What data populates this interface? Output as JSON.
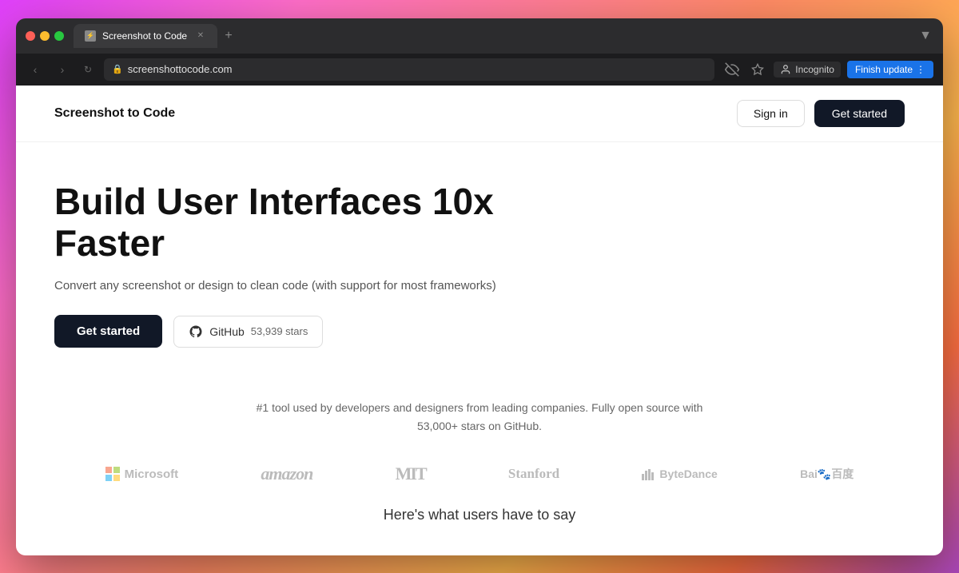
{
  "browser": {
    "tab_title": "Screenshot to Code",
    "tab_icon": "⚡",
    "new_tab_label": "+",
    "expand_label": "▼",
    "back_label": "‹",
    "forward_label": "›",
    "refresh_label": "↻",
    "url": "screenshottocode.com",
    "url_icon": "🔒",
    "eyeoff_icon": "👁",
    "bookmark_icon": "☆",
    "incognito_label": "Incognito",
    "incognito_icon": "🕵",
    "finish_update_label": "Finish update",
    "more_icon": "⋮"
  },
  "nav": {
    "logo": "Screenshot to Code",
    "sign_in": "Sign in",
    "get_started": "Get started"
  },
  "hero": {
    "title": "Build User Interfaces 10x Faster",
    "subtitle": "Convert any screenshot or design to clean code (with support for most frameworks)",
    "get_started": "Get started",
    "github_label": "GitHub",
    "github_stars": "53,939 stars"
  },
  "social_proof": {
    "text": "#1 tool used by developers and designers from leading companies. Fully open source with 53,000+ stars on GitHub.",
    "companies": [
      {
        "name": "Microsoft",
        "id": "microsoft"
      },
      {
        "name": "amazon",
        "id": "amazon"
      },
      {
        "name": "mit",
        "id": "mit"
      },
      {
        "name": "Stanford",
        "id": "stanford"
      },
      {
        "name": "ByteDance",
        "id": "bytedance"
      },
      {
        "name": "Baidu",
        "id": "baidu"
      }
    ]
  },
  "testimonials": {
    "header": "Here's what users have to say"
  }
}
